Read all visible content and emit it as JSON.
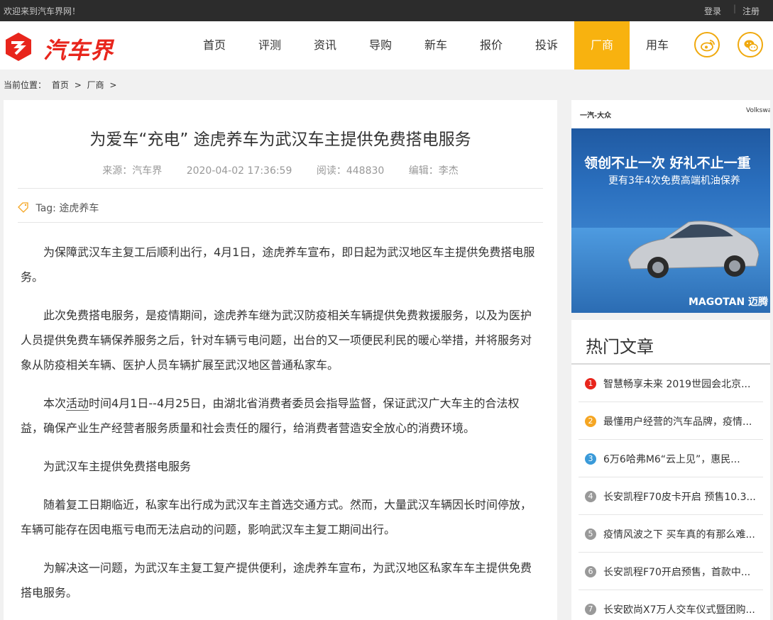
{
  "topbar": {
    "welcome": "欢迎来到汽车界网！",
    "login": "登录",
    "separator": "|",
    "register": "注册"
  },
  "logo": {
    "text": "汽车界"
  },
  "nav": [
    {
      "label": "首页"
    },
    {
      "label": "评测"
    },
    {
      "label": "资讯"
    },
    {
      "label": "导购"
    },
    {
      "label": "新车"
    },
    {
      "label": "报价"
    },
    {
      "label": "投诉"
    },
    {
      "label": "厂商",
      "active": true
    },
    {
      "label": "用车"
    }
  ],
  "breadcrumb": {
    "prefix": "当前位置：",
    "home": "首页",
    "arrow": ">",
    "section": "厂商",
    "tail": ">"
  },
  "article": {
    "title": "为爱车“充电” 途虎养车为武汉车主提供免费搭电服务",
    "source": "来源：汽车界",
    "datetime": "2020-04-02 17:36:59",
    "reads": "阅读：448830",
    "editor": "编辑：李杰",
    "tag_prefix": "Tag:",
    "tag": "途虎养车",
    "p1": "为保障武汉车主复工后顺利出行，4月1日，途虎养车宣布，即日起为武汉地区车主提供免费搭电服务。",
    "p2": "此次免费搭电服务，是疫情期间，途虎养车继为武汉防疫相关车辆提供免费救援服务，以及为医护人员提供免费车辆保养服务之后，针对车辆亏电问题，出台的又一项便民利民的暖心举措，并将服务对象从防疫相关车辆、医护人员车辆扩展至武汉地区普通私家车。",
    "p3_a": "本次",
    "p3_link": "活动",
    "p3_b": "时间4月1日--4月25日，由湖北省消费者委员会指导监督，保证武汉广大车主的合法权益，确保产业生产经营者服务质量和社会责任的履行，给消费者营造安全放心的消费环境。",
    "p4": "为武汉车主提供免费搭电服务",
    "p5": "随着复工日期临近，私家车出行成为武汉车主首选交通方式。然而，大量武汉车辆因长时间停放，车辆可能存在因电瓶亏电而无法启动的问题，影响武汉车主复工期间出行。",
    "p6": "为解决这一问题，为武汉车主复工复产提供便利，途虎养车宣布，为武汉地区私家车车主提供免费搭电服务。"
  },
  "ad": {
    "brand_left": "一汽-大众",
    "brand_right": "Volkswagen",
    "headline": "领创不止一次  好礼不止一重",
    "subline": "更有3年4次免费高端机油保养",
    "model": "MAGOTAN 迈腾"
  },
  "hot": {
    "title": "热门文章",
    "items": [
      {
        "num": "1",
        "title": "智慧畅享未来 2019世园会北京...",
        "color": "#e8251c"
      },
      {
        "num": "2",
        "title": "最懂用户经营的汽车品牌，疫情...",
        "color": "#f5a623"
      },
      {
        "num": "3",
        "title": "6万6哈弗M6“云上见”，惠民...",
        "color": "#3a9ad9"
      },
      {
        "num": "4",
        "title": "长安凯程F70皮卡开启 预售10.3...",
        "color": "#999999"
      },
      {
        "num": "5",
        "title": "疫情风波之下 买车真的有那么难...",
        "color": "#999999"
      },
      {
        "num": "6",
        "title": "长安凯程F70开启预售，首款中...",
        "color": "#999999"
      },
      {
        "num": "7",
        "title": "长安欧尚X7万人交车仪式暨团购...",
        "color": "#999999"
      }
    ]
  }
}
